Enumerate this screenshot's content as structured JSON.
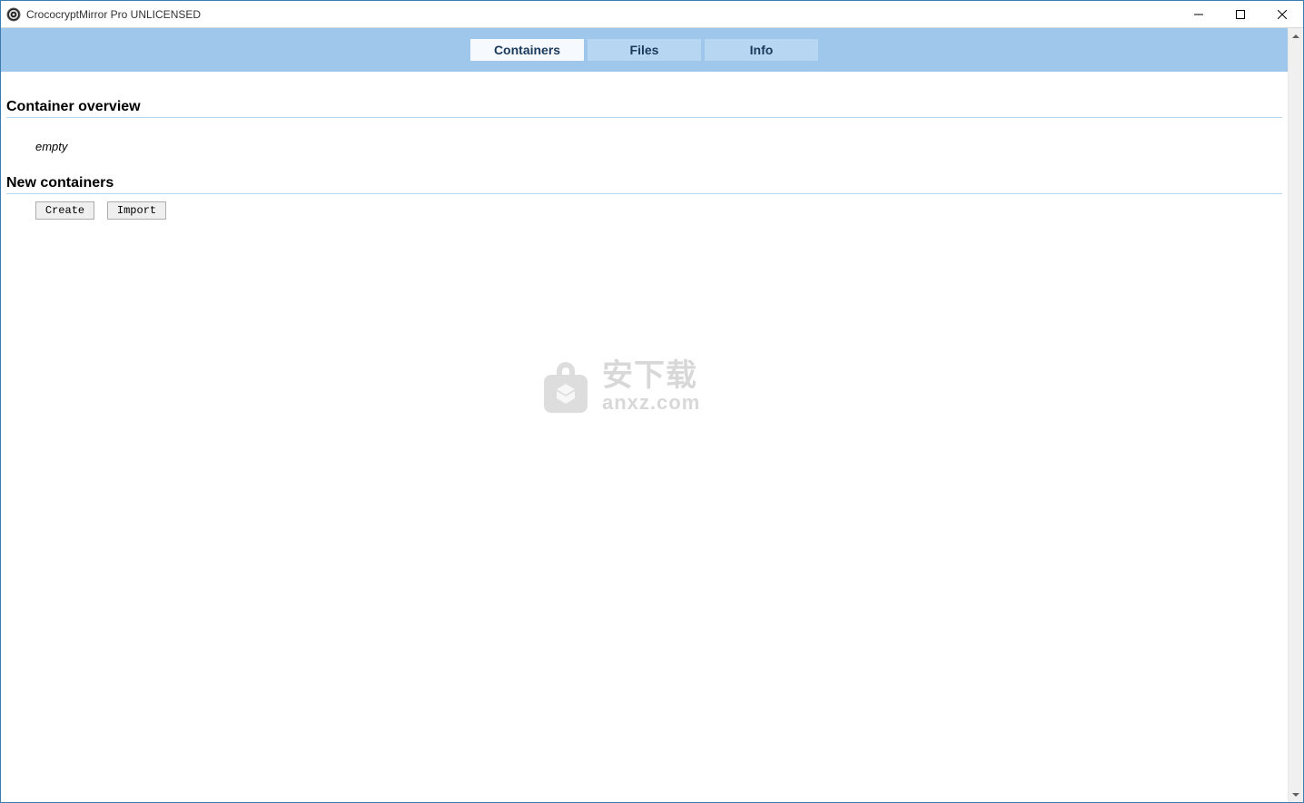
{
  "window": {
    "title": "CrococryptMirror Pro UNLICENSED"
  },
  "tabs": {
    "containers": "Containers",
    "files": "Files",
    "info": "Info"
  },
  "sections": {
    "overview_title": "Container overview",
    "overview_empty": "empty",
    "new_title": "New containers"
  },
  "buttons": {
    "create": "Create",
    "import": "Import"
  },
  "watermark": {
    "line1": "安下载",
    "line2": "anxz.com"
  }
}
